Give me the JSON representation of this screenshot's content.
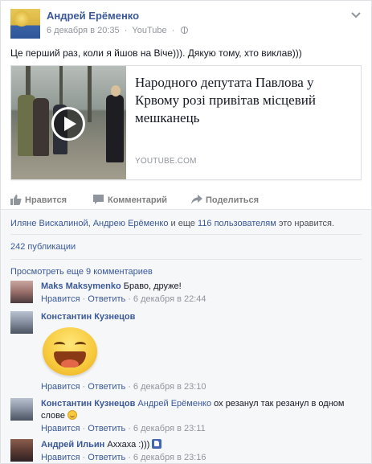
{
  "post": {
    "author": "Андрей Ерёменко",
    "date": "6 декабря в 20:35",
    "source": "YouTube",
    "text": "Це перший раз, коли я йшов на Віче))). Дякую тому, хто виклав)))"
  },
  "share": {
    "title": "Народного депутата Павлова у Крвому розі привітав місцевий мешканець",
    "domain": "YOUTUBE.COM"
  },
  "actions": {
    "like": "Нравится",
    "comment": "Комментарий",
    "share": "Поделиться"
  },
  "likes": {
    "name1": "Иляне Вискалиной",
    "comma": ",",
    "name2": "Андрею Ерёменко",
    "and": "и еще",
    "others": "116 пользователям",
    "suffix": "это нравится."
  },
  "shares_count": "242 публикации",
  "more_comments": "Просмотреть еще 9 комментариев",
  "comments": [
    {
      "author": "Maks Maksymenko",
      "text": "Браво, друже!",
      "like": "Нравится",
      "reply": "Ответить",
      "time": "6 декабря в 22:44"
    },
    {
      "author": "Константин Кузнецов",
      "text": "",
      "like": "Нравится",
      "reply": "Ответить",
      "time": "6 декабря в 23:10"
    },
    {
      "author": "Константин Кузнецов",
      "mention": "Андрей Ерёменко",
      "text": "ох резанул так резанул в одном слове",
      "like": "Нравится",
      "reply": "Ответить",
      "time": "6 декабря в 23:11"
    },
    {
      "author": "Андрей Ильин",
      "text": "Аххаха :)))",
      "like": "Нравится",
      "reply": "Ответить",
      "time": "6 декабря в 23:16"
    }
  ],
  "separator": "·",
  "colors": {
    "link": "#3b5998",
    "meta": "#90949c",
    "ufi_bg": "#f6f7f9"
  }
}
